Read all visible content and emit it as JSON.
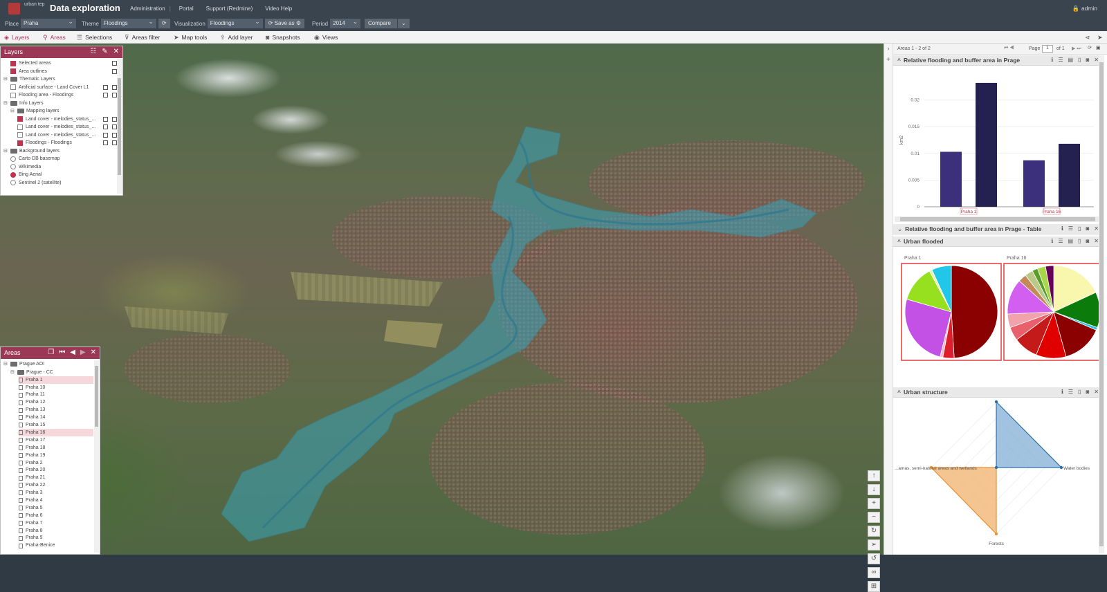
{
  "header": {
    "logo_text": "urban tep",
    "title": "Data exploration",
    "nav": [
      "Administration",
      "Portal",
      "Support (Redmine)",
      "Video Help"
    ],
    "user": "admin"
  },
  "selectors": {
    "place_label": "Place",
    "place_value": "Praha",
    "theme_label": "Theme",
    "theme_value": "Floodings",
    "visualization_label": "Visualization",
    "visualization_value": "Floodings",
    "save_as": "Save as",
    "period_label": "Period",
    "period_value": "2014",
    "compare": "Compare"
  },
  "toolbar": {
    "items": [
      "Layers",
      "Areas",
      "Selections",
      "Areas filter",
      "Map tools",
      "Add layer",
      "Snapshots",
      "Views"
    ]
  },
  "layers_panel": {
    "title": "Layers",
    "rows": [
      {
        "type": "check",
        "on": true,
        "label": "Selected areas",
        "indent": 1
      },
      {
        "type": "check",
        "on": true,
        "label": "Area outlines",
        "indent": 1
      },
      {
        "type": "folder",
        "label": "Thematic Layers",
        "indent": 0
      },
      {
        "type": "check",
        "on": false,
        "label": "Artificial surface - Land Cover L1",
        "indent": 1
      },
      {
        "type": "check",
        "on": false,
        "label": "Flooding area - Floodings",
        "indent": 1
      },
      {
        "type": "folder",
        "label": "Info Layers",
        "indent": 0
      },
      {
        "type": "folder",
        "label": "Mapping layers",
        "indent": 1
      },
      {
        "type": "check",
        "on": true,
        "label": "Land cover - melodies_status_...",
        "indent": 2
      },
      {
        "type": "check",
        "on": false,
        "label": "Land cover - melodies_status_...",
        "indent": 2
      },
      {
        "type": "check",
        "on": false,
        "label": "Land cover - melodies_status_...",
        "indent": 2
      },
      {
        "type": "check",
        "on": true,
        "label": "Floodings - Floodings",
        "indent": 2
      },
      {
        "type": "folder",
        "label": "Background layers",
        "indent": 0
      },
      {
        "type": "radio",
        "on": false,
        "label": "Carto DB basemap",
        "indent": 1
      },
      {
        "type": "radio",
        "on": false,
        "label": "Wikimedia",
        "indent": 1
      },
      {
        "type": "radio",
        "on": true,
        "label": "Bing Aerial",
        "indent": 1
      },
      {
        "type": "radio",
        "on": false,
        "label": "Sentinel 2 (satellite)",
        "indent": 1
      }
    ]
  },
  "areas_panel": {
    "title": "Areas",
    "root": "Prague AOI",
    "group": "Prague - CC",
    "items": [
      "Praha 1",
      "Praha 10",
      "Praha 11",
      "Praha 12",
      "Praha 13",
      "Praha 14",
      "Praha 15",
      "Praha 16",
      "Praha 17",
      "Praha 18",
      "Praha 19",
      "Praha 2",
      "Praha 20",
      "Praha 21",
      "Praha 22",
      "Praha 3",
      "Praha 4",
      "Praha 5",
      "Praha 6",
      "Praha 7",
      "Praha 8",
      "Praha 9",
      "Praha-Benice"
    ],
    "highlighted": [
      "Praha 1",
      "Praha 16"
    ]
  },
  "sidebar": {
    "areas_count": "Areas 1 - 2 of 2",
    "page_label": "Page",
    "page_value": "1",
    "page_of": "of 1",
    "widgets": {
      "w1_title": "Relative flooding and buffer area in Prage",
      "w2_title": "Relative flooding and buffer area in Prage - Table",
      "w3_title": "Urban flooded",
      "w4_title": "Urban structure"
    }
  },
  "chart_data": [
    {
      "type": "bar",
      "title": "Relative flooding and buffer area in Prage",
      "ylabel": "km2",
      "categories": [
        "Praha 1",
        "Praha 16"
      ],
      "series": [
        {
          "values": [
            0.0103,
            0.0087
          ],
          "color": "#3c2f7c"
        },
        {
          "values": [
            0.0232,
            0.0118
          ],
          "color": "#24204f"
        }
      ],
      "ylim": [
        0,
        0.025
      ],
      "yticks": [
        "0",
        "0.005",
        "0.01",
        "0.015",
        "0.02"
      ]
    },
    {
      "type": "pie",
      "title": "Urban flooded",
      "charts": [
        {
          "label": "Praha 1",
          "slices": [
            {
              "value": 50,
              "color": "#8b0000"
            },
            {
              "value": 4,
              "color": "#dd1f2b"
            },
            {
              "value": 1,
              "color": "#f3b9c6"
            },
            {
              "value": 26,
              "color": "#c451e5"
            },
            {
              "value": 13,
              "color": "#96e01f"
            },
            {
              "value": 1,
              "color": "#e8f5a4"
            },
            {
              "value": 7,
              "color": "#21c7e8"
            }
          ]
        },
        {
          "label": "Praha 16",
          "slices": [
            {
              "value": 19,
              "color": "#f9f7ad"
            },
            {
              "value": 13,
              "color": "#0b7c0b"
            },
            {
              "value": 1,
              "color": "#2bbfe0"
            },
            {
              "value": 15,
              "color": "#8b0000"
            },
            {
              "value": 11,
              "color": "#e00000"
            },
            {
              "value": 9,
              "color": "#c41a1a"
            },
            {
              "value": 5,
              "color": "#e8606c"
            },
            {
              "value": 5,
              "color": "#f0a3ab"
            },
            {
              "value": 13,
              "color": "#d35ff0"
            },
            {
              "value": 3,
              "color": "#c28a5a"
            },
            {
              "value": 3,
              "color": "#b9c987"
            },
            {
              "value": 2,
              "color": "#5a9c2a"
            },
            {
              "value": 3,
              "color": "#a8d84a"
            },
            {
              "value": 3,
              "color": "#68005a"
            }
          ]
        }
      ]
    },
    {
      "type": "radar",
      "title": "Urban structure",
      "axes": [
        "Water bodies",
        "Forests",
        "...amas, semi-natural areas and wetlands"
      ],
      "series": [
        {
          "color": "#2e6fa8",
          "fill": "#7aa9d3"
        },
        {
          "color": "#e8912f",
          "fill": "#f0b06c"
        }
      ]
    }
  ]
}
